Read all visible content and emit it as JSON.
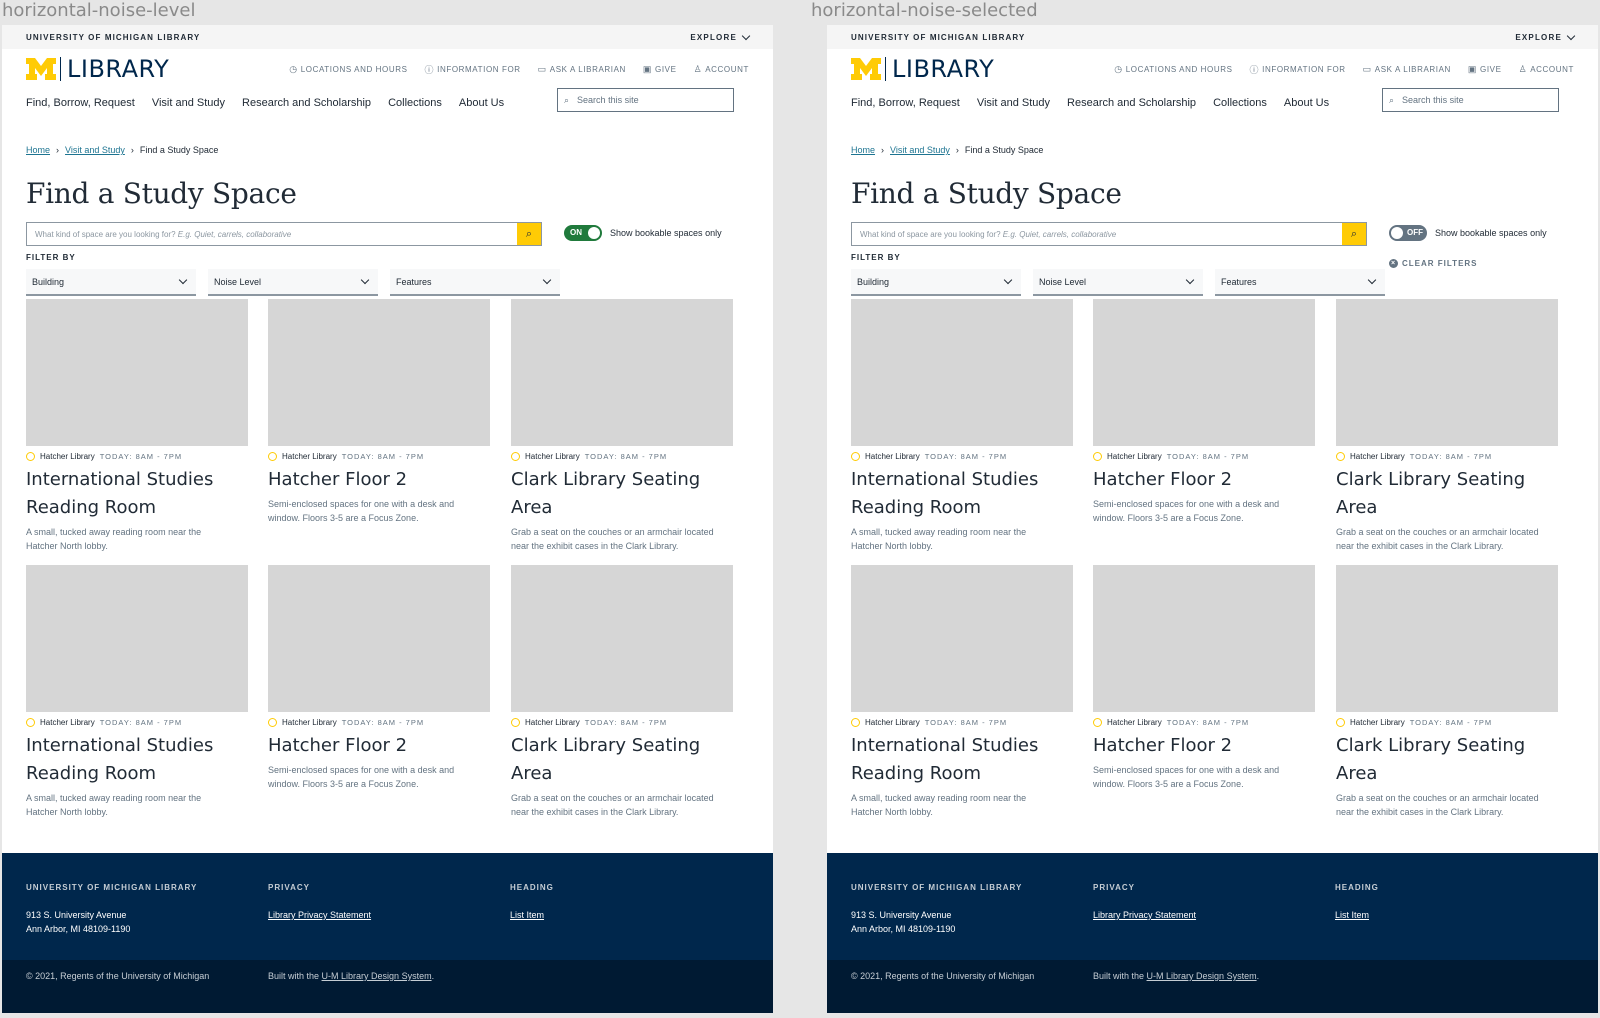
{
  "frames": [
    {
      "label": "horizontal-noise-level",
      "toggle": {
        "state": "on",
        "text": "ON",
        "label": "Show bookable spaces only"
      },
      "clear_filters": ""
    },
    {
      "label": "horizontal-noise-selected",
      "toggle": {
        "state": "off",
        "text": "OFF",
        "label": "Show bookable spaces only"
      },
      "clear_filters": "CLEAR FILTERS"
    }
  ],
  "topbar": {
    "site": "UNIVERSITY OF MICHIGAN LIBRARY",
    "explore": "EXPLORE"
  },
  "logo": {
    "text": "LIBRARY"
  },
  "utility_links": [
    "LOCATIONS AND HOURS",
    "INFORMATION FOR",
    "ASK A LIBRARIAN",
    "GIVE",
    "ACCOUNT"
  ],
  "utility_icons": [
    "clock-icon",
    "info-icon",
    "chat-icon",
    "gift-icon",
    "person-icon"
  ],
  "nav": [
    "Find, Borrow, Request",
    "Visit and Study",
    "Research and Scholarship",
    "Collections",
    "About Us"
  ],
  "site_search": {
    "placeholder": "Search this site"
  },
  "breadcrumb": {
    "home": "Home",
    "parent": "Visit and Study",
    "current": "Find a Study Space"
  },
  "page_title": "Find a Study Space",
  "query": {
    "placeholder_plain": "What kind of space are you looking for?",
    "placeholder_example": "E.g. Quiet, carrels, collaborative"
  },
  "filter_by": "FILTER BY",
  "filters": [
    "Building",
    "Noise Level",
    "Features"
  ],
  "cards": [
    {
      "library": "Hatcher Library",
      "hours": "TODAY: 8AM - 7PM",
      "title_1": "International Studies",
      "title_2": "Reading Room",
      "desc_1": "A small, tucked away reading room near the",
      "desc_2": "Hatcher North lobby."
    },
    {
      "library": "Hatcher Library",
      "hours": "TODAY: 8AM - 7PM",
      "title_1": "Hatcher Floor 2",
      "title_2": "",
      "desc_1": "Semi-enclosed spaces for one with a desk and",
      "desc_2": "window. Floors 3-5 are a Focus Zone."
    },
    {
      "library": "Hatcher Library",
      "hours": "TODAY: 8AM - 7PM",
      "title_1": "Clark Library Seating",
      "title_2": "Area",
      "desc_1": "Grab a seat on the couches or an armchair located",
      "desc_2": "near the exhibit cases in the Clark Library."
    },
    {
      "library": "Hatcher Library",
      "hours": "TODAY: 8AM - 7PM",
      "title_1": "International Studies",
      "title_2": "Reading Room",
      "desc_1": "A small, tucked away reading room near the",
      "desc_2": "Hatcher North lobby."
    },
    {
      "library": "Hatcher Library",
      "hours": "TODAY: 8AM - 7PM",
      "title_1": "Hatcher Floor 2",
      "title_2": "",
      "desc_1": "Semi-enclosed spaces for one with a desk and",
      "desc_2": "window. Floors 3-5 are a Focus Zone."
    },
    {
      "library": "Hatcher Library",
      "hours": "TODAY: 8AM - 7PM",
      "title_1": "Clark Library Seating",
      "title_2": "Area",
      "desc_1": "Grab a seat on the couches or an armchair located",
      "desc_2": "near the exhibit cases in the Clark Library."
    }
  ],
  "footer": {
    "col1_heading": "UNIVERSITY OF MICHIGAN LIBRARY",
    "address_1": "913 S. University Avenue",
    "address_2": "Ann Arbor, MI 48109-1190",
    "col2_heading": "PRIVACY",
    "privacy_link": "Library Privacy Statement",
    "col3_heading": "HEADING",
    "list_item": "List Item",
    "copyright": "© 2021, Regents of the University of Michigan",
    "built_prefix": "Built with the",
    "built_link": "U-M Library Design System",
    "built_suffix": "."
  },
  "colors": {
    "brand_navy": "#00274c",
    "maize": "#ffcb05",
    "toggle_on": "#207a3c",
    "toggle_off": "#637381",
    "link": "#1d7491"
  }
}
